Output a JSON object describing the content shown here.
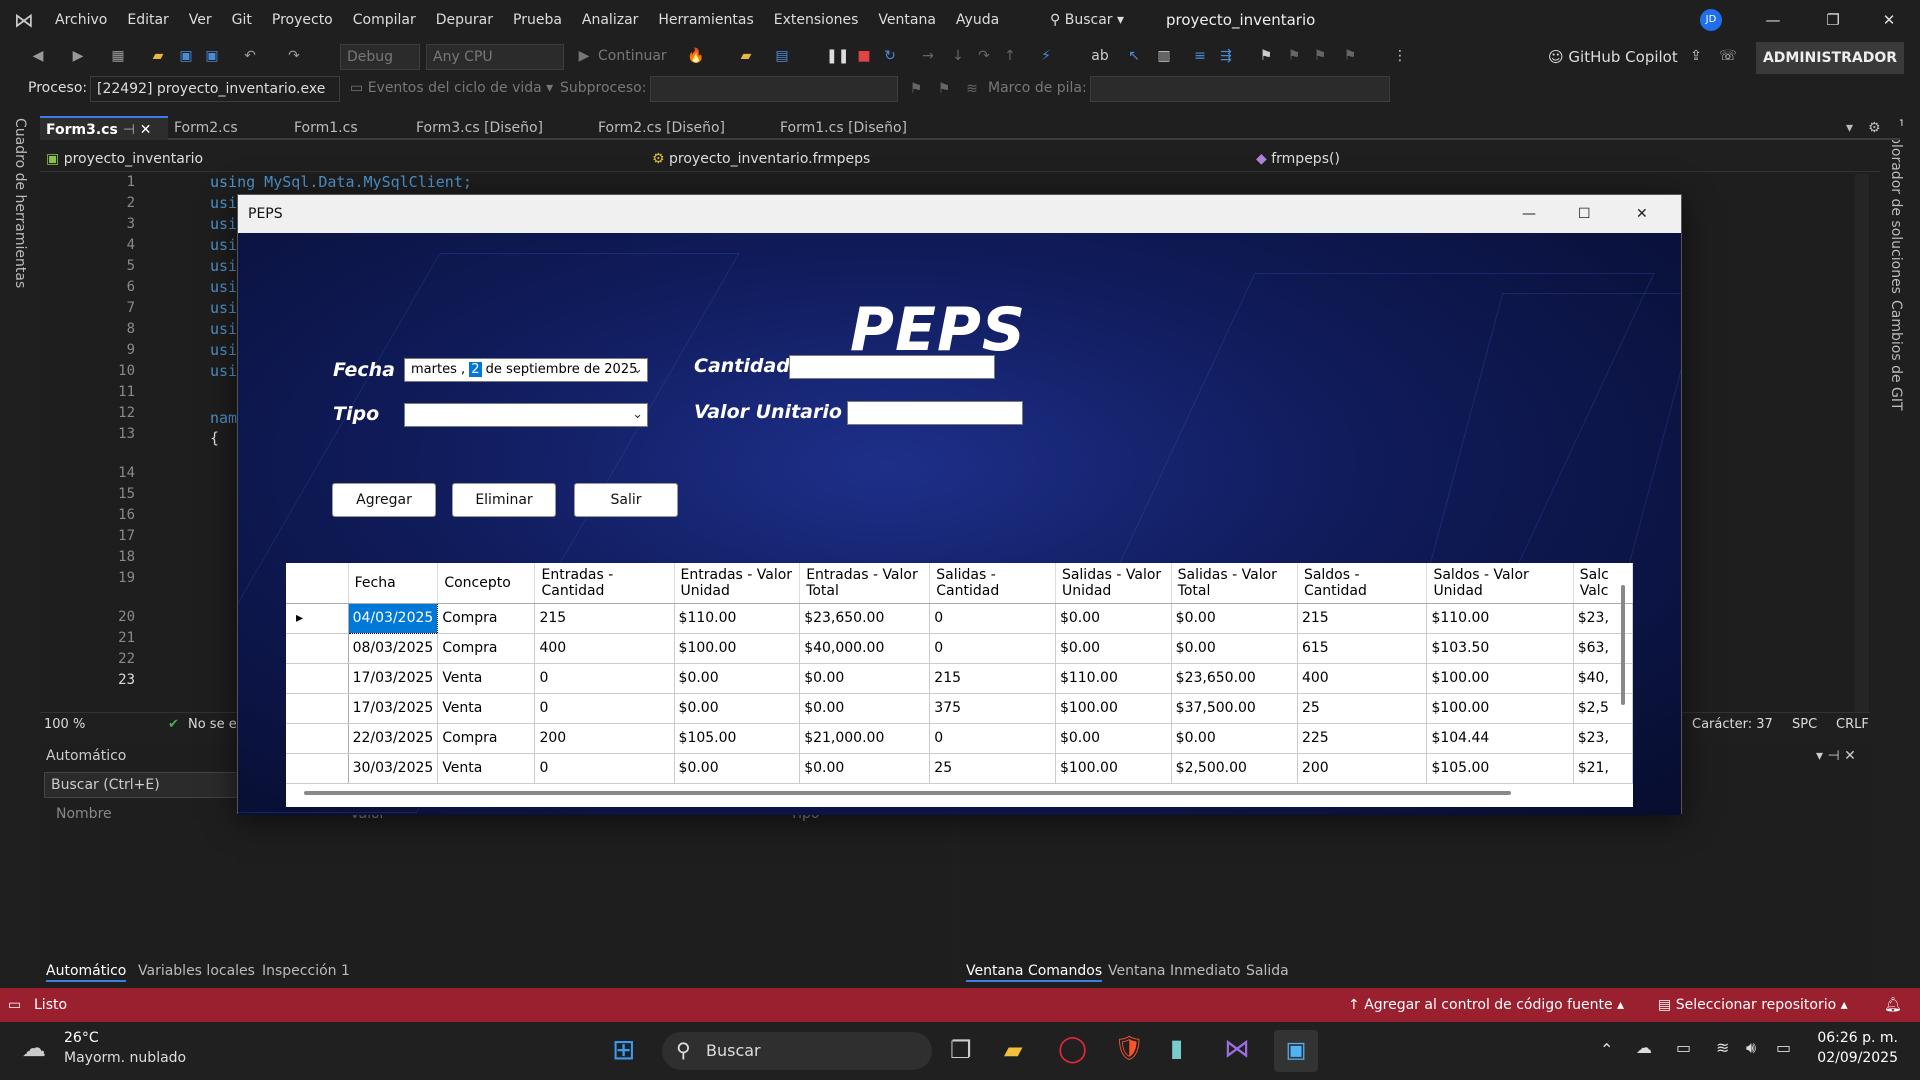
{
  "menu": {
    "items": [
      "Archivo",
      "Editar",
      "Ver",
      "Git",
      "Proyecto",
      "Compilar",
      "Depurar",
      "Prueba",
      "Analizar",
      "Herramientas",
      "Extensiones",
      "Ventana",
      "Ayuda"
    ],
    "search_label": "Buscar",
    "project_title": "proyecto_inventario",
    "avatar": "JD"
  },
  "toolbar": {
    "config": "Debug",
    "platform": "Any CPU",
    "continue_label": "Continuar",
    "copilot_label": "GitHub Copilot",
    "admin_label": "ADMINISTRADOR"
  },
  "process_bar": {
    "process_label": "Proceso:",
    "process_value": "[22492] proyecto_inventario.exe",
    "lifecycle_label": "Eventos del ciclo de vida",
    "subprocess_label": "Subproceso:",
    "stackframe_label": "Marco de pila:"
  },
  "tabs": [
    "Form3.cs",
    "Form2.cs",
    "Form1.cs",
    "Form3.cs [Diseño]",
    "Form2.cs [Diseño]",
    "Form1.cs [Diseño]"
  ],
  "navbar": {
    "project": "proyecto_inventario",
    "class": "proyecto_inventario.frmpeps",
    "member": "frmpeps()"
  },
  "editor": {
    "line_numbers": [
      "1",
      "2",
      "3",
      "4",
      "5",
      "6",
      "7",
      "8",
      "9",
      "10",
      "11",
      "12",
      "13",
      "14",
      "15",
      "16",
      "17",
      "18",
      "19",
      "20",
      "21",
      "22",
      "23"
    ],
    "line1": "using MySql.Data.MySqlClient;",
    "line_using": "usi",
    "line_nam": "nam",
    "line_brace": "{",
    "zoom": "100 %",
    "issues": "No se e",
    "caret": "Carácter: 37",
    "spc": "SPC",
    "crlf": "CRLF"
  },
  "side_labels": {
    "left": "Cuadro de herramientas",
    "right1": "Explorador de soluciones",
    "right2": "Cambios de GIT"
  },
  "auto_panel": {
    "title": "Automático",
    "search": "Buscar (Ctrl+E)",
    "col_name": "Nombre",
    "col_value": "Valor",
    "col_type": "Tipo",
    "tabs": [
      "Automático",
      "Variables locales",
      "Inspección 1"
    ]
  },
  "cmd_panel": {
    "tabs": [
      "Ventana Comandos",
      "Ventana Inmediato",
      "Salida"
    ]
  },
  "statusbar": {
    "ready": "Listo",
    "source_control": "Agregar al control de código fuente",
    "repo": "Seleccionar repositorio"
  },
  "taskbar": {
    "temp": "26°C",
    "weather": "Mayorm. nublado",
    "search": "Buscar",
    "time": "06:26 p. m.",
    "date": "02/09/2025"
  },
  "peps": {
    "window_title": "PEPS",
    "heading": "PEPS",
    "fecha_label": "Fecha",
    "fecha_day": "martes",
    "fecha_num": "2",
    "fecha_rest": "de septiembre de 2025",
    "tipo_label": "Tipo",
    "cantidad_label": "Cantidad",
    "valor_label": "Valor Unitario",
    "btn_add": "Agregar",
    "btn_del": "Eliminar",
    "btn_exit": "Salir",
    "columns": [
      "Fecha",
      "Concepto",
      "Entradas - Cantidad",
      "Entradas - Valor Unidad",
      "Entradas - Valor Total",
      "Salidas - Cantidad",
      "Salidas - Valor Unidad",
      "Salidas - Valor Total",
      "Saldos - Cantidad",
      "Saldos - Valor Unidad",
      "Salc Valc"
    ],
    "rows": [
      [
        "04/03/2025",
        "Compra",
        "215",
        "$110.00",
        "$23,650.00",
        "0",
        "$0.00",
        "$0.00",
        "215",
        "$110.00",
        "$23,"
      ],
      [
        "08/03/2025",
        "Compra",
        "400",
        "$100.00",
        "$40,000.00",
        "0",
        "$0.00",
        "$0.00",
        "615",
        "$103.50",
        "$63,"
      ],
      [
        "17/03/2025",
        "Venta",
        "0",
        "$0.00",
        "$0.00",
        "215",
        "$110.00",
        "$23,650.00",
        "400",
        "$100.00",
        "$40,"
      ],
      [
        "17/03/2025",
        "Venta",
        "0",
        "$0.00",
        "$0.00",
        "375",
        "$100.00",
        "$37,500.00",
        "25",
        "$100.00",
        "$2,5"
      ],
      [
        "22/03/2025",
        "Compra",
        "200",
        "$105.00",
        "$21,000.00",
        "0",
        "$0.00",
        "$0.00",
        "225",
        "$104.44",
        "$23,"
      ],
      [
        "30/03/2025",
        "Venta",
        "0",
        "$0.00",
        "$0.00",
        "25",
        "$100.00",
        "$2,500.00",
        "200",
        "$105.00",
        "$21,"
      ]
    ]
  }
}
